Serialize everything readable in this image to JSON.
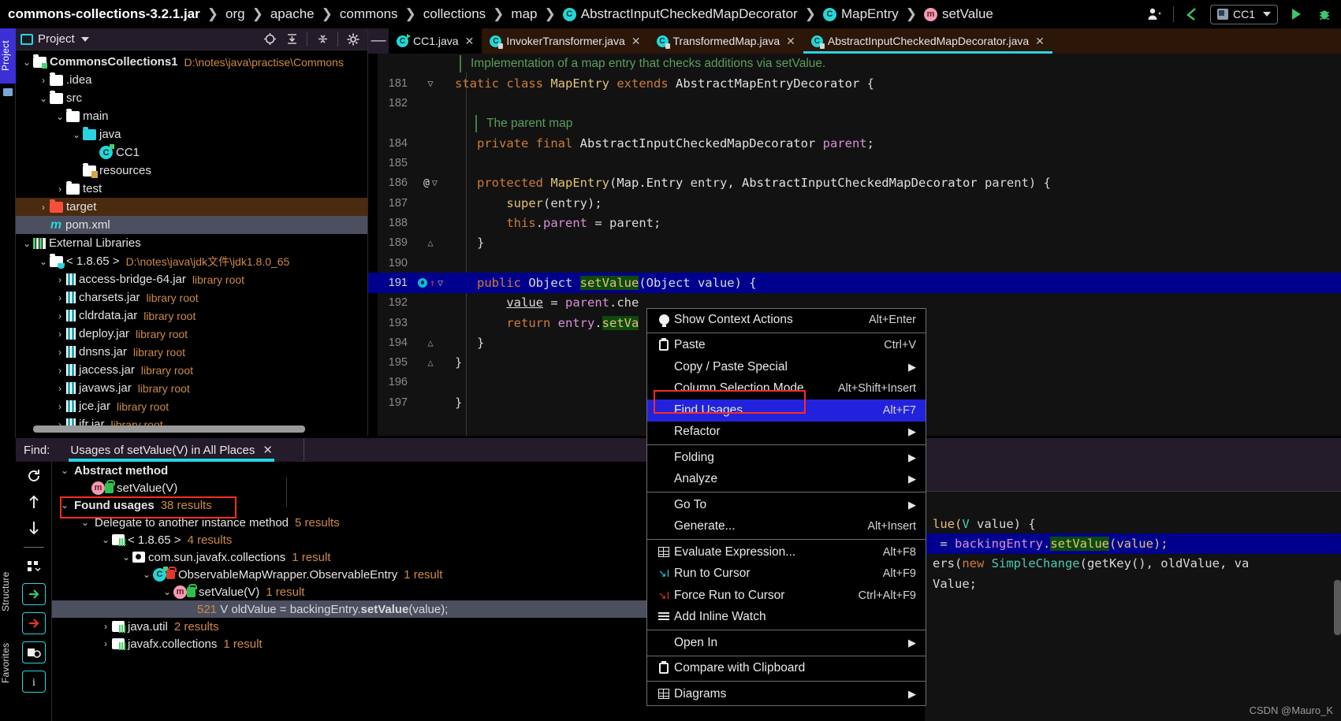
{
  "breadcrumb": {
    "items": [
      {
        "label": "commons-collections-3.2.1.jar",
        "bold": true,
        "icon": null
      },
      {
        "label": "org",
        "bold": false,
        "icon": null
      },
      {
        "label": "apache",
        "bold": false,
        "icon": null
      },
      {
        "label": "commons",
        "bold": false,
        "icon": null
      },
      {
        "label": "collections",
        "bold": false,
        "icon": null
      },
      {
        "label": "map",
        "bold": false,
        "icon": null
      },
      {
        "label": "AbstractInputCheckedMapDecorator",
        "bold": false,
        "icon": "class-icon"
      },
      {
        "label": "MapEntry",
        "bold": false,
        "icon": "class-icon"
      },
      {
        "label": "setValue",
        "bold": false,
        "icon": "method-icon"
      }
    ],
    "separator": "❯"
  },
  "toolbar": {
    "run_config": "CC1",
    "icons": [
      "user-icon",
      "back-arrow-icon",
      "run-icon",
      "debug-icon"
    ]
  },
  "left_strip": {
    "project_tab": "Project",
    "structure_tab": "Structure",
    "favorites_tab": "Favorites"
  },
  "project_panel": {
    "title": "Project",
    "header_icons": [
      "locate-icon",
      "collapse-all-icon",
      "expand-icon",
      "gear-icon",
      "hide-icon"
    ],
    "tree": [
      {
        "depth": 0,
        "arrow": "v",
        "icon": "module-folder",
        "label": "CommonsCollections1",
        "bold": true,
        "sub": "D:\\notes\\java\\practise\\Commons",
        "state": "normal"
      },
      {
        "depth": 1,
        "arrow": ">",
        "icon": "folder",
        "label": ".idea",
        "bold": false,
        "sub": "",
        "state": "normal"
      },
      {
        "depth": 1,
        "arrow": "v",
        "icon": "folder",
        "label": "src",
        "bold": false,
        "sub": "",
        "state": "normal"
      },
      {
        "depth": 2,
        "arrow": "v",
        "icon": "folder",
        "label": "main",
        "bold": false,
        "sub": "",
        "state": "normal"
      },
      {
        "depth": 3,
        "arrow": "v",
        "icon": "folder-cyan",
        "label": "java",
        "bold": false,
        "sub": "",
        "state": "normal"
      },
      {
        "depth": 4,
        "arrow": "",
        "icon": "class-run",
        "label": "CC1",
        "bold": false,
        "sub": "",
        "state": "normal"
      },
      {
        "depth": 3,
        "arrow": "",
        "icon": "folder-resources",
        "label": "resources",
        "bold": false,
        "sub": "",
        "state": "normal"
      },
      {
        "depth": 2,
        "arrow": ">",
        "icon": "folder",
        "label": "test",
        "bold": false,
        "sub": "",
        "state": "normal"
      },
      {
        "depth": 1,
        "arrow": ">",
        "icon": "folder-red",
        "label": "target",
        "bold": false,
        "sub": "",
        "state": "target"
      },
      {
        "depth": 1,
        "arrow": "",
        "icon": "maven-icon",
        "label": "pom.xml",
        "bold": false,
        "sub": "",
        "state": "selected"
      },
      {
        "depth": 0,
        "arrow": "v",
        "icon": "libraries-icon",
        "label": "External Libraries",
        "bold": false,
        "sub": "",
        "state": "normal"
      },
      {
        "depth": 1,
        "arrow": "v",
        "icon": "folder-jdk",
        "label": "< 1.8.65 >",
        "bold": false,
        "sub": "D:\\notes\\java\\jdk文件\\jdk1.8.0_65",
        "state": "normal"
      },
      {
        "depth": 2,
        "arrow": ">",
        "icon": "jar-icon",
        "label": "access-bridge-64.jar",
        "bold": false,
        "sub": "library root",
        "state": "normal"
      },
      {
        "depth": 2,
        "arrow": ">",
        "icon": "jar-icon",
        "label": "charsets.jar",
        "bold": false,
        "sub": "library root",
        "state": "normal"
      },
      {
        "depth": 2,
        "arrow": ">",
        "icon": "jar-icon",
        "label": "cldrdata.jar",
        "bold": false,
        "sub": "library root",
        "state": "normal"
      },
      {
        "depth": 2,
        "arrow": ">",
        "icon": "jar-icon",
        "label": "deploy.jar",
        "bold": false,
        "sub": "library root",
        "state": "normal"
      },
      {
        "depth": 2,
        "arrow": ">",
        "icon": "jar-icon",
        "label": "dnsns.jar",
        "bold": false,
        "sub": "library root",
        "state": "normal"
      },
      {
        "depth": 2,
        "arrow": ">",
        "icon": "jar-icon",
        "label": "jaccess.jar",
        "bold": false,
        "sub": "library root",
        "state": "normal"
      },
      {
        "depth": 2,
        "arrow": ">",
        "icon": "jar-icon",
        "label": "javaws.jar",
        "bold": false,
        "sub": "library root",
        "state": "normal"
      },
      {
        "depth": 2,
        "arrow": ">",
        "icon": "jar-icon",
        "label": "jce.jar",
        "bold": false,
        "sub": "library root",
        "state": "normal"
      },
      {
        "depth": 2,
        "arrow": ">",
        "icon": "jar-icon",
        "label": "jfr.jar",
        "bold": false,
        "sub": "library root",
        "state": "normal"
      }
    ]
  },
  "editor": {
    "tabs": [
      {
        "label": "CC1.java",
        "icon": "class-run-icon",
        "closable": true,
        "active": false
      },
      {
        "label": "InvokerTransformer.java",
        "icon": "class-lock-icon",
        "closable": true,
        "active": false
      },
      {
        "label": "TransformedMap.java",
        "icon": "class-lock-icon",
        "closable": true,
        "active": false
      },
      {
        "label": "AbstractInputCheckedMapDecorator.java",
        "icon": "class-lock-icon",
        "closable": true,
        "active": true
      }
    ],
    "doc_comment_1": "Implementation of a map entry that checks additions via setValue.",
    "doc_comment_2": "The parent map",
    "lines": [
      {
        "num": "181",
        "gutter": "fold-open",
        "marker": ""
      },
      {
        "num": "182",
        "gutter": "",
        "marker": ""
      },
      {
        "num": "184",
        "gutter": "",
        "marker": ""
      },
      {
        "num": "185",
        "gutter": "",
        "marker": ""
      },
      {
        "num": "186",
        "gutter": "fold-open",
        "marker": "@"
      },
      {
        "num": "187",
        "gutter": "",
        "marker": ""
      },
      {
        "num": "188",
        "gutter": "",
        "marker": ""
      },
      {
        "num": "189",
        "gutter": "fold-end",
        "marker": ""
      },
      {
        "num": "190",
        "gutter": "",
        "marker": ""
      },
      {
        "num": "191",
        "gutter": "fold-open",
        "marker": "override"
      },
      {
        "num": "192",
        "gutter": "",
        "marker": ""
      },
      {
        "num": "193",
        "gutter": "",
        "marker": ""
      },
      {
        "num": "194",
        "gutter": "fold-end",
        "marker": ""
      },
      {
        "num": "195",
        "gutter": "fold-end",
        "marker": ""
      },
      {
        "num": "196",
        "gutter": "",
        "marker": ""
      },
      {
        "num": "197",
        "gutter": "",
        "marker": ""
      }
    ],
    "code": {
      "l181": "static class MapEntry extends AbstractMapEntryDecorator {",
      "l184": "private final AbstractInputCheckedMapDecorator parent;",
      "l186": "protected MapEntry(Map.Entry entry, AbstractInputCheckedMapDecorator parent) {",
      "l187": "super(entry);",
      "l188": "this.parent = parent;",
      "l189": "}",
      "l191": "public Object setValue(Object value) {",
      "l192": "value = parent.che",
      "l193": "return entry.setVa",
      "l194": "}",
      "l195": "}",
      "l197": "}"
    }
  },
  "context_menu": {
    "items": [
      {
        "label": "Show Context Actions",
        "accel": "Alt+Enter",
        "icon": "lightbulb-icon",
        "submenu": false,
        "selected": false,
        "sep_after": true
      },
      {
        "label": "Paste",
        "accel": "Ctrl+V",
        "icon": "clipboard-icon",
        "submenu": false,
        "selected": false,
        "sep_after": false
      },
      {
        "label": "Copy / Paste Special",
        "accel": "",
        "icon": "",
        "submenu": true,
        "selected": false,
        "sep_after": false
      },
      {
        "label": "Column Selection Mode",
        "accel": "Alt+Shift+Insert",
        "icon": "",
        "submenu": false,
        "selected": false,
        "sep_after": false
      },
      {
        "label": "Find Usages",
        "accel": "Alt+F7",
        "icon": "",
        "submenu": false,
        "selected": true,
        "sep_after": false
      },
      {
        "label": "Refactor",
        "accel": "",
        "icon": "",
        "submenu": true,
        "selected": false,
        "sep_after": true
      },
      {
        "label": "Folding",
        "accel": "",
        "icon": "",
        "submenu": true,
        "selected": false,
        "sep_after": false
      },
      {
        "label": "Analyze",
        "accel": "",
        "icon": "",
        "submenu": true,
        "selected": false,
        "sep_after": true
      },
      {
        "label": "Go To",
        "accel": "",
        "icon": "",
        "submenu": true,
        "selected": false,
        "sep_after": false
      },
      {
        "label": "Generate...",
        "accel": "Alt+Insert",
        "icon": "",
        "submenu": false,
        "selected": false,
        "sep_after": true
      },
      {
        "label": "Evaluate Expression...",
        "accel": "Alt+F8",
        "icon": "evaluate-icon",
        "submenu": false,
        "selected": false,
        "sep_after": false
      },
      {
        "label": "Run to Cursor",
        "accel": "Alt+F9",
        "icon": "run-to-cursor-icon",
        "submenu": false,
        "selected": false,
        "sep_after": false
      },
      {
        "label": "Force Run to Cursor",
        "accel": "Ctrl+Alt+F9",
        "icon": "force-run-to-cursor-icon",
        "submenu": false,
        "selected": false,
        "sep_after": false
      },
      {
        "label": "Add Inline Watch",
        "accel": "",
        "icon": "inline-watch-icon",
        "submenu": false,
        "selected": false,
        "sep_after": true
      },
      {
        "label": "Open In",
        "accel": "",
        "icon": "",
        "submenu": true,
        "selected": false,
        "sep_after": true
      },
      {
        "label": "Compare with Clipboard",
        "accel": "",
        "icon": "compare-icon",
        "submenu": false,
        "selected": false,
        "sep_after": true
      },
      {
        "label": "Diagrams",
        "accel": "",
        "icon": "diagrams-icon",
        "submenu": true,
        "selected": false,
        "sep_after": false
      }
    ]
  },
  "find_panel": {
    "label": "Find:",
    "tab_title": "Usages of setValue(V) in All Places",
    "tools": [
      "rerun-icon",
      "prev-occurrence-icon",
      "next-occurrence-icon",
      "group-by-icon",
      "expand-all-icon",
      "collapse-all-icon",
      "export-icon",
      "help-icon"
    ],
    "results": [
      {
        "depth": 0,
        "arrow": "v",
        "icon": "",
        "label": "Abstract method",
        "bold": true,
        "count": "",
        "selected": false
      },
      {
        "depth": 1,
        "arrow": "",
        "icon": "method-lock",
        "label": "setValue(V)",
        "bold": false,
        "count": "",
        "selected": false
      },
      {
        "depth": 0,
        "arrow": "v",
        "icon": "",
        "label": "Found usages",
        "bold": true,
        "count": "38 results",
        "selected": false
      },
      {
        "depth": 1,
        "arrow": "v",
        "icon": "",
        "label": "Delegate to another instance method",
        "bold": false,
        "count": "5 results",
        "selected": false
      },
      {
        "depth": 2,
        "arrow": "v",
        "icon": "module",
        "label": "< 1.8.65 >",
        "bold": false,
        "count": "4 results",
        "selected": false
      },
      {
        "depth": 3,
        "arrow": "v",
        "icon": "package",
        "label": "com.sun.javafx.collections",
        "bold": false,
        "count": "1 result",
        "selected": false
      },
      {
        "depth": 4,
        "arrow": "v",
        "icon": "class-lock",
        "label": "ObservableMapWrapper.ObservableEntry",
        "bold": false,
        "count": "1 result",
        "selected": false
      },
      {
        "depth": 5,
        "arrow": "v",
        "icon": "method-lock",
        "label": "setValue(V)",
        "bold": false,
        "count": "1 result",
        "selected": false
      },
      {
        "depth": 6,
        "arrow": "",
        "icon": "",
        "label": "521 V oldValue = backingEntry.setValue(value);",
        "bold": false,
        "count": "",
        "selected": true
      },
      {
        "depth": 2,
        "arrow": ">",
        "icon": "module",
        "label": "java.util",
        "bold": false,
        "count": "2 results",
        "selected": false
      },
      {
        "depth": 2,
        "arrow": ">",
        "icon": "module",
        "label": "javafx.collections",
        "bold": false,
        "count": "1 result",
        "selected": false
      }
    ],
    "preview_lines": [
      "lue(V value) {",
      "= backingEntry.setValue(value);",
      "ers(new SimpleChange(getKey(), oldValue, va",
      "Value;"
    ],
    "watermark": "CSDN @Mauro_K"
  },
  "colors": {
    "accent": "#2ad4e0",
    "selection_blue": "#2222dd",
    "highlight_red": "#ff2b21",
    "comment_green": "#5a9e5a",
    "keyword_orange": "#cf7b37",
    "count_orange": "#cd8a46"
  }
}
